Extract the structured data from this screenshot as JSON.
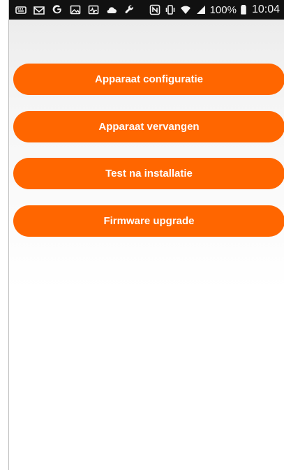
{
  "status_bar": {
    "left_icons": [
      {
        "name": "keyboard-icon"
      },
      {
        "name": "gmail-icon"
      },
      {
        "name": "google-icon"
      },
      {
        "name": "gallery-icon"
      },
      {
        "name": "activity-icon"
      },
      {
        "name": "cloud-icon"
      },
      {
        "name": "wrench-icon"
      }
    ],
    "right_icons": [
      {
        "name": "nfc-icon"
      },
      {
        "name": "vibrate-icon"
      },
      {
        "name": "wifi-icon"
      },
      {
        "name": "signal-icon"
      }
    ],
    "battery_text": "100%",
    "time": "10:04"
  },
  "buttons": [
    {
      "label": "Apparaat configuratie"
    },
    {
      "label": "Apparaat vervangen"
    },
    {
      "label": "Test na installatie"
    },
    {
      "label": "Firmware upgrade"
    }
  ],
  "colors": {
    "accent": "#ff6600",
    "status_bar": "#111111"
  }
}
